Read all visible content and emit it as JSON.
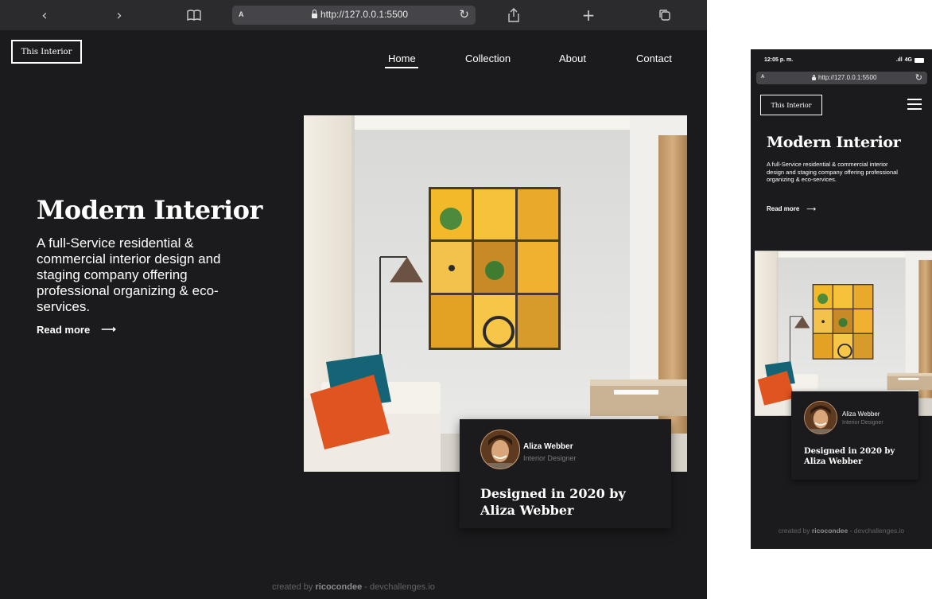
{
  "browser": {
    "url": "http://127.0.0.1:5500",
    "text_size_label": "A",
    "icons": [
      "back-icon",
      "forward-icon",
      "bookmarks-icon",
      "reload-icon",
      "share-icon",
      "new-tab-icon",
      "tabs-icon"
    ]
  },
  "phone_status": {
    "time": "12:05 p. m.",
    "network": "4G"
  },
  "site": {
    "logo": "This Interior",
    "nav": [
      "Home",
      "Collection",
      "About",
      "Contact"
    ],
    "active_nav": "Home",
    "hero": {
      "title": "Modern Interior",
      "description": "A full-Service residential & commercial interior design and staging company offering professional organizing & eco-services.",
      "read_more": "Read more",
      "arrow": "⟶"
    },
    "card": {
      "name": "Aliza Webber",
      "role": "Interior Designer",
      "title": "Designed in 2020 by Aliza Webber"
    },
    "footer": {
      "prefix": "created by",
      "author": "ricocondee",
      "suffix": "- devchallenges.io"
    }
  },
  "colors": {
    "background": "#1b1b1d",
    "toolbar": "#2b2b2e",
    "accent_yellow": "#f2b92a",
    "cushion_orange": "#e0541f",
    "cushion_teal": "#146476"
  }
}
